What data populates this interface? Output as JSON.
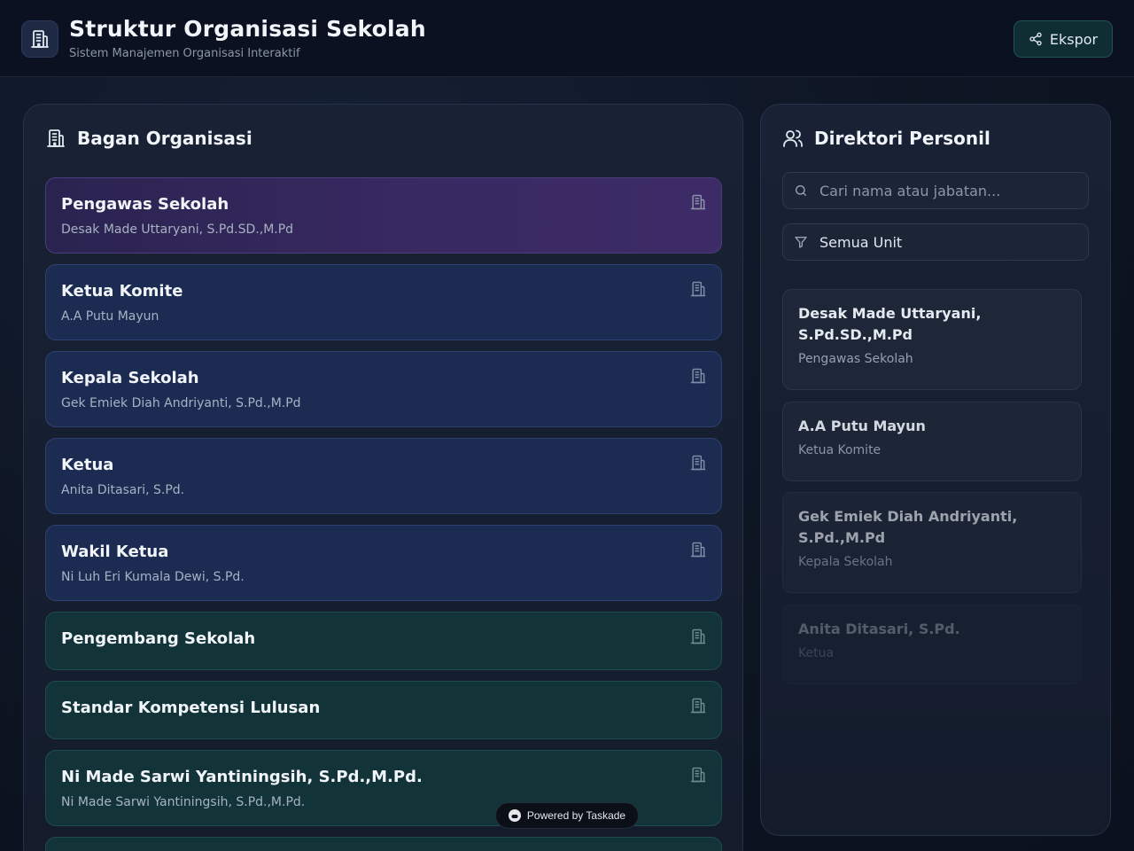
{
  "header": {
    "title": "Struktur Organisasi Sekolah",
    "subtitle": "Sistem Manajemen Organisasi Interaktif",
    "export_label": "Ekspor",
    "logo_icon": "building-icon",
    "export_icon": "share-icon"
  },
  "org_chart": {
    "title": "Bagan Organisasi",
    "icon": "building-icon",
    "cards": [
      {
        "title": "Pengawas Sekolah",
        "name": "Desak Made Uttaryani, S.Pd.SD.,M.Pd",
        "color": "purple"
      },
      {
        "title": "Ketua Komite",
        "name": "A.A Putu Mayun",
        "color": "blue"
      },
      {
        "title": "Kepala Sekolah",
        "name": "Gek Emiek Diah Andriyanti, S.Pd.,M.Pd",
        "color": "blue"
      },
      {
        "title": "Ketua",
        "name": "Anita Ditasari, S.Pd.",
        "color": "blue"
      },
      {
        "title": "Wakil Ketua",
        "name": "Ni Luh Eri Kumala Dewi, S.Pd.",
        "color": "blue"
      },
      {
        "title": "Pengembang Sekolah",
        "name": "",
        "color": "teal"
      },
      {
        "title": "Standar Kompetensi Lulusan",
        "name": "",
        "color": "teal"
      },
      {
        "title": "Ni Made Sarwi Yantiningsih, S.Pd.,M.Pd.",
        "name": "Ni Made Sarwi Yantiningsih, S.Pd.,M.Pd.",
        "color": "teal"
      }
    ]
  },
  "directory": {
    "title": "Direktori Personil",
    "icon": "users-icon",
    "search_placeholder": "Cari nama atau jabatan...",
    "filter_value": "Semua Unit",
    "people": [
      {
        "name_line1": "Desak Made Uttaryani,",
        "name_line2": "S.Pd.SD.,M.Pd",
        "role": "Pengawas Sekolah"
      },
      {
        "name_line1": "A.A Putu Mayun",
        "name_line2": "",
        "role": "Ketua Komite"
      },
      {
        "name_line1": "Gek Emiek Diah Andriyanti,",
        "name_line2": "S.Pd.,M.Pd",
        "role": "Kepala Sekolah"
      },
      {
        "name_line1": "Anita Ditasari, S.Pd.",
        "name_line2": "",
        "role": "Ketua"
      }
    ]
  },
  "footer": {
    "powered_label": "Powered by Taskade"
  },
  "colors": {
    "background": "#0f172a",
    "card_purple": "#3a2a63",
    "card_blue": "#1c2b52",
    "card_teal": "#123438"
  }
}
